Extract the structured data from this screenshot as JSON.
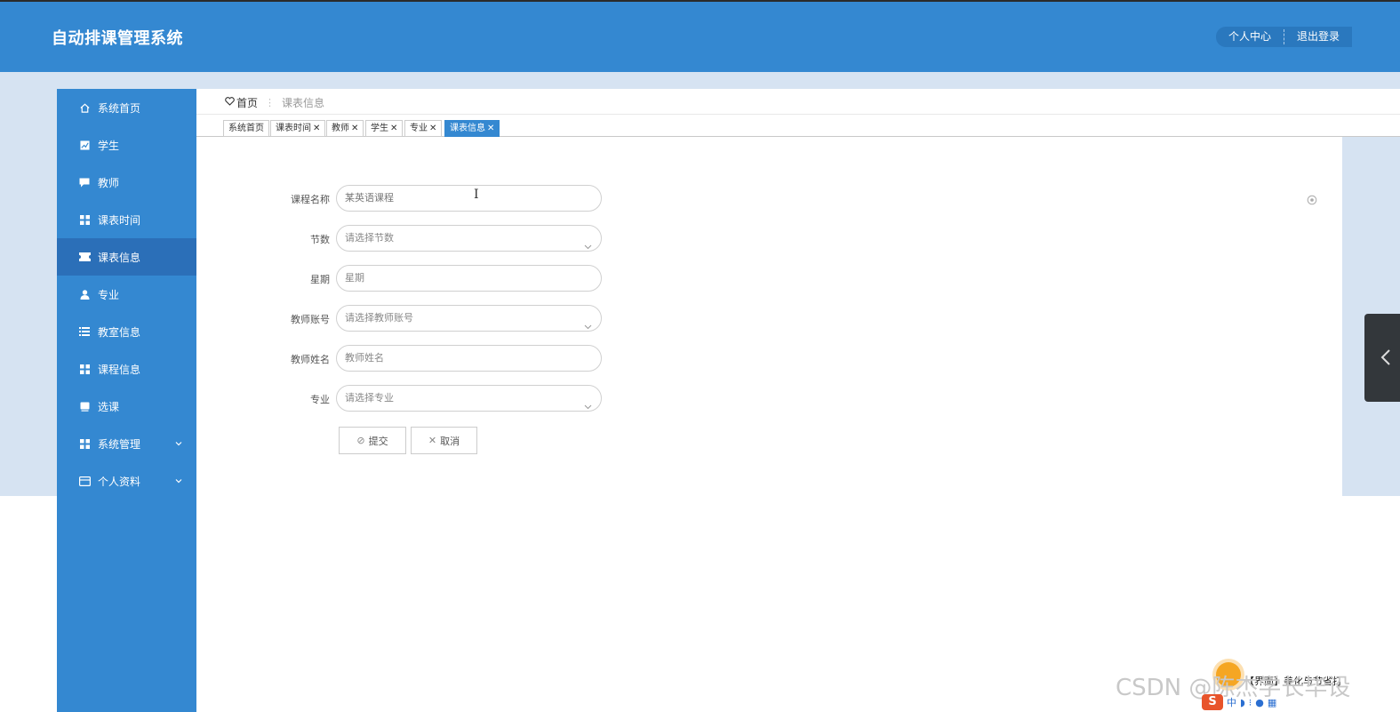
{
  "header": {
    "title": "自动排课管理系统",
    "personal_center": "个人中心",
    "logout": "退出登录"
  },
  "sidebar": {
    "items": [
      {
        "label": "系统首页",
        "icon": "home-icon"
      },
      {
        "label": "学生",
        "icon": "chart-icon"
      },
      {
        "label": "教师",
        "icon": "comment-icon"
      },
      {
        "label": "课表时间",
        "icon": "grid-icon"
      },
      {
        "label": "课表信息",
        "icon": "ticket-icon",
        "active": true
      },
      {
        "label": "专业",
        "icon": "user-icon"
      },
      {
        "label": "教室信息",
        "icon": "list-icon"
      },
      {
        "label": "课程信息",
        "icon": "grid-icon"
      },
      {
        "label": "选课",
        "icon": "book-icon"
      },
      {
        "label": "系统管理",
        "icon": "grid-icon",
        "expandable": true
      },
      {
        "label": "个人资料",
        "icon": "card-icon",
        "expandable": true
      }
    ]
  },
  "breadcrumb": {
    "home": "首页",
    "separator": "⋮",
    "current": "课表信息"
  },
  "tabs": [
    {
      "label": "系统首页",
      "closable": false
    },
    {
      "label": "课表时间",
      "closable": true
    },
    {
      "label": "教师",
      "closable": true
    },
    {
      "label": "学生",
      "closable": true
    },
    {
      "label": "专业",
      "closable": true
    },
    {
      "label": "课表信息",
      "closable": true,
      "active": true
    }
  ],
  "form": {
    "course_name": {
      "label": "课程名称",
      "value": "某英语课程"
    },
    "period": {
      "label": "节数",
      "placeholder": "请选择节数"
    },
    "weekday": {
      "label": "星期",
      "placeholder": "星期"
    },
    "teacher_account": {
      "label": "教师账号",
      "placeholder": "请选择教师账号"
    },
    "teacher_name": {
      "label": "教师姓名",
      "placeholder": "教师姓名"
    },
    "major": {
      "label": "专业",
      "placeholder": "请选择专业"
    },
    "submit": "提交",
    "cancel": "取消"
  },
  "overlay": {
    "watermark": "CSDN @陈杰学长毕设",
    "ime_status": "【界面】美化与节省打"
  },
  "colors": {
    "primary": "#3488d1",
    "active_menu": "#2b6fb8",
    "page_bg": "#d6e3f2"
  }
}
